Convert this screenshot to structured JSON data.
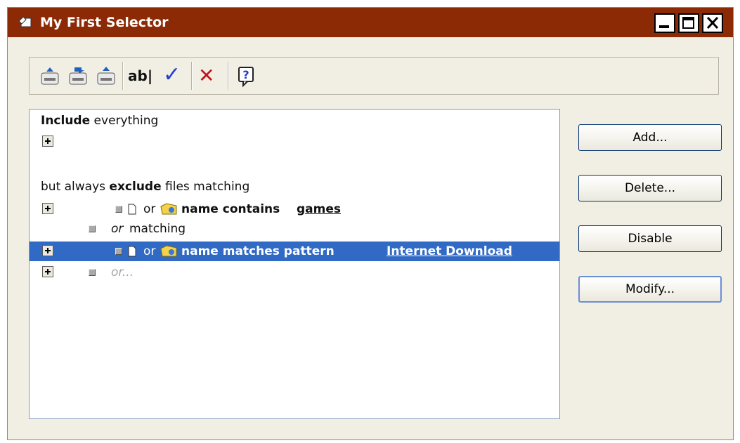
{
  "window": {
    "title": "My First Selector"
  },
  "toolbar": {
    "items": [
      "save-icon",
      "save-as-icon",
      "open-icon",
      "rename-icon",
      "check-icon",
      "delete-icon",
      "help-icon"
    ],
    "rename_label": "ab|",
    "check_glyph": "✓",
    "delete_glyph": "✕",
    "help_glyph": "?"
  },
  "rules": {
    "include_keyword": "Include",
    "include_rest": "everything",
    "exclude_prefix": "but always",
    "exclude_keyword": "exclude",
    "exclude_suffix": "files matching",
    "rule1": {
      "or": "or",
      "condition": "name contains",
      "value": "games"
    },
    "or_matching": {
      "or": "or",
      "text": "matching"
    },
    "rule2": {
      "or": "or",
      "condition": "name matches pattern",
      "value": "Internet Download"
    },
    "or_placeholder": "or..."
  },
  "buttons": {
    "add": "Add...",
    "delete": "Delete...",
    "disable": "Disable",
    "modify": "Modify..."
  },
  "colors": {
    "titlebar": "#8c2a06",
    "selection": "#316ac5",
    "window_bg": "#f1efe3"
  }
}
